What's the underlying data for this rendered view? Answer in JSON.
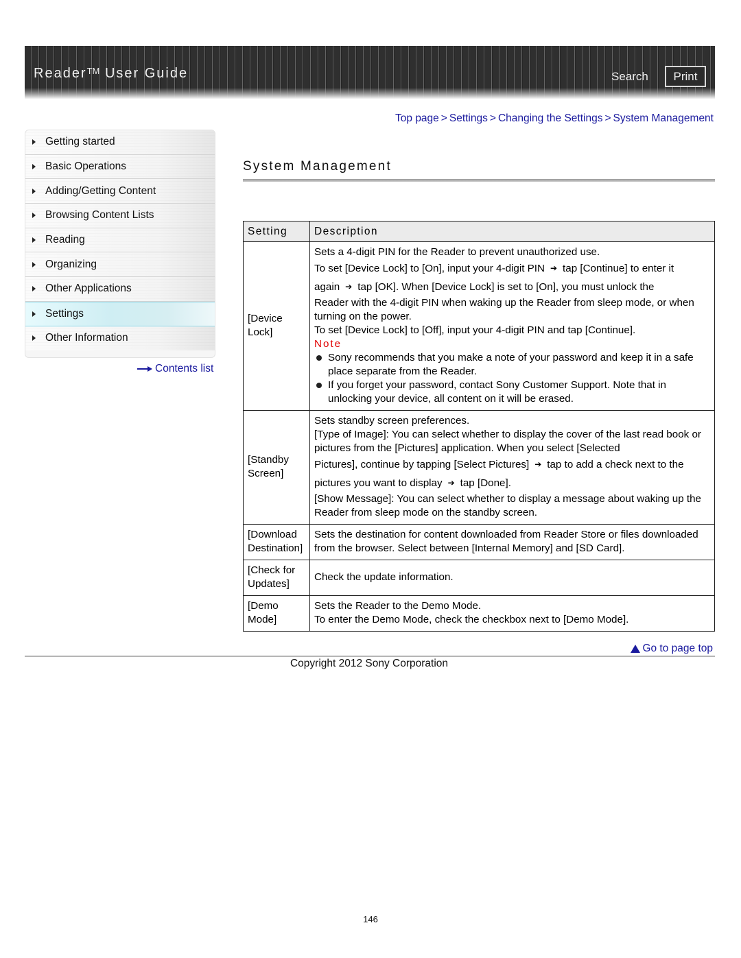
{
  "header": {
    "title": "Reader",
    "trademark": "TM",
    "title_rest": " User Guide",
    "search_label": "Search",
    "print_label": "Print"
  },
  "sidebar": {
    "items": [
      {
        "label": "Getting started",
        "active": false
      },
      {
        "label": "Basic Operations",
        "active": false
      },
      {
        "label": "Adding/Getting Content",
        "active": false
      },
      {
        "label": "Browsing Content Lists",
        "active": false
      },
      {
        "label": "Reading",
        "active": false
      },
      {
        "label": "Organizing",
        "active": false
      },
      {
        "label": "Other Applications",
        "active": false
      },
      {
        "label": "Settings",
        "active": true
      },
      {
        "label": "Other Information",
        "active": false
      }
    ],
    "contents_list_label": "Contents list"
  },
  "breadcrumb": {
    "items": [
      "Top page",
      "Settings",
      "Changing the Settings",
      "System Management"
    ],
    "separator": ">"
  },
  "page": {
    "title": "System Management"
  },
  "table": {
    "headers": [
      "Setting",
      "Description"
    ],
    "rows": [
      {
        "setting": "[Device Lock]",
        "lines": [
          "Sets a 4-digit PIN for the Reader to prevent unauthorized use.",
          "To set [Device Lock] to [On], input your 4-digit PIN",
          "tap [Continue] to enter it",
          "again",
          "tap [OK]. When [Device Lock] is set to [On], you must unlock the",
          "Reader with the 4-digit PIN when waking up the Reader from sleep mode, or when turning on the power.",
          "To set [Device Lock] to [Off], input your 4-digit PIN and tap [Continue]."
        ],
        "note_label": "Note",
        "notes": [
          "Sony recommends that you make a note of your password and keep it in a safe place separate from the Reader.",
          "If you forget your password, contact Sony Customer Support. Note that in unlocking your device, all content on it will be erased."
        ]
      },
      {
        "setting": "[Standby Screen]",
        "lines": [
          "Sets standby screen preferences.",
          "[Type of Image]: You can select whether to display the cover of the last read book or pictures from the [Pictures] application. When you select [Selected",
          "Pictures], continue by tapping [Select Pictures]",
          "tap to add a check next to the",
          "pictures you want to display",
          "tap [Done].",
          "[Show Message]: You can select whether to display a message about waking up the Reader from sleep mode on the standby screen."
        ]
      },
      {
        "setting": "[Download Destination]",
        "lines": [
          "Sets the destination for content downloaded from Reader Store or files downloaded from the browser. Select between [Internal Memory] and [SD Card]."
        ]
      },
      {
        "setting": "[Check for Updates]",
        "lines": [
          "Check the update information."
        ]
      },
      {
        "setting": "[Demo Mode]",
        "lines": [
          "Sets the Reader to the Demo Mode.",
          "To enter the Demo Mode, check the checkbox next to [Demo Mode]."
        ]
      }
    ]
  },
  "icons": {
    "arrow": "➔",
    "contents_arrow": "⟶"
  },
  "footer": {
    "go_to_top_label": "Go to page top",
    "copyright": "Copyright 2012 Sony Corporation",
    "page_number": "146"
  },
  "colors": {
    "link": "#1a1a9e",
    "note": "#e00000",
    "active_nav": "#cfeef3"
  }
}
